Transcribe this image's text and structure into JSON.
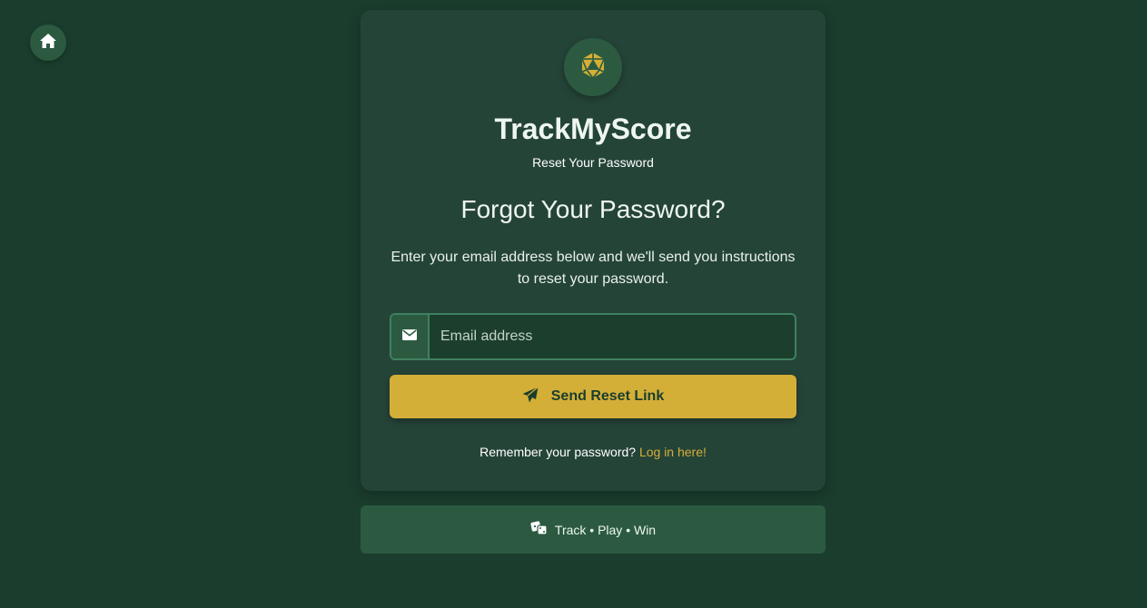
{
  "nav": {
    "home_icon": "home-icon"
  },
  "brand": {
    "logo_icon": "dice-d20-icon",
    "name": "TrackMyScore",
    "subtitle": "Reset Your Password"
  },
  "form": {
    "heading": "Forgot Your Password?",
    "description": "Enter your email address below and we'll send you instructions to reset your password.",
    "email": {
      "icon": "envelope-icon",
      "placeholder": "Email address",
      "value": ""
    },
    "submit": {
      "icon": "paper-plane-icon",
      "label": "Send Reset Link"
    },
    "remember_text": "Remember your password?",
    "login_link": "Log in here!"
  },
  "footer": {
    "icon": "dice-icon",
    "tagline": "Track • Play • Win"
  },
  "colors": {
    "background": "#1b3d2d",
    "card": "#254438",
    "accent": "#d4af37",
    "secondary": "#2b5a41",
    "border": "#3f8060"
  }
}
